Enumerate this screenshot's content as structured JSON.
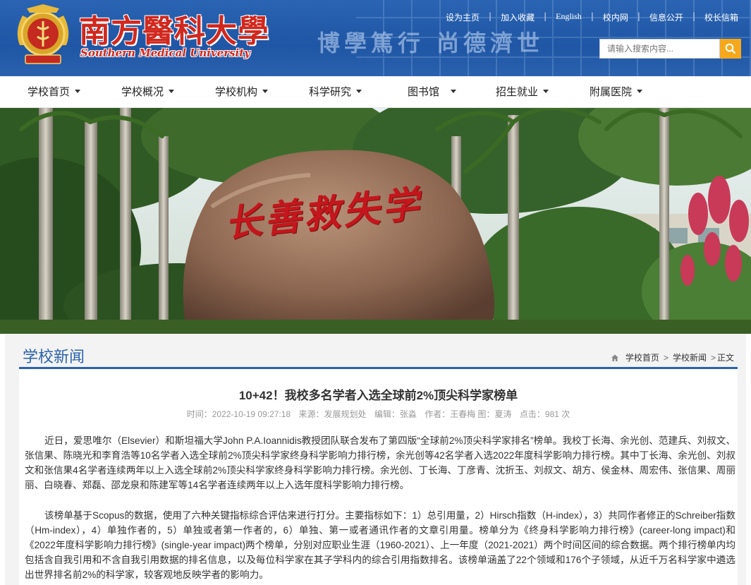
{
  "header": {
    "logo_cn": "南方醫科大學",
    "logo_en": "Southern Medical University",
    "motto": "博學篤行 尚德濟世",
    "top_links": [
      "设为主页",
      "加入收藏",
      "English",
      "校内网",
      "信息公开",
      "校长信箱"
    ],
    "search_placeholder": "请输入搜索内容..."
  },
  "nav": [
    "学校首页",
    "学校概况",
    "学校机构",
    "科学研究",
    "图书馆",
    "招生就业",
    "附属医院"
  ],
  "banner": {
    "rock_text": "长善救失学"
  },
  "section": {
    "title": "学校新闻",
    "breadcrumb": [
      "学校首页",
      "学校新闻",
      "正文"
    ]
  },
  "article": {
    "title": "10+42！我校多名学者入选全球前2%顶尖科学家榜单",
    "meta": {
      "time": "时间：2022-10-19 09:27:18",
      "source": "来源：发展规划处",
      "editor": "编辑：张淼",
      "author": "作者：王春梅 图：夏涛",
      "clicks": "点击：981 次"
    },
    "paragraphs": [
      "近日，爱思唯尔（Elsevier）和斯坦福大学John P.A.Ioannidis教授团队联合发布了第四版“全球前2%顶尖科学家排名”榜单。我校丁长海、余光创、范建兵、刘叔文、张信果、陈晓光和李育浩等10名学者入选全球前2%顶尖科学家终身科学影响力排行榜，余光创等42名学者入选2022年度科学影响力排行榜。其中丁长海、余光创、刘叔文和张信果4名学者连续两年以上入选全球前2%顶尖科学家终身科学影响力排行榜。余光创、丁长海、丁彦青、沈折玉、刘叔文、胡方、侯金林、周宏伟、张信果、周丽丽、白晓春、郑磊、邵龙泉和陈建军等14名学者连续两年以上入选年度科学影响力排行榜。",
      "该榜单基于Scopus的数据，使用了六种关键指标综合评估来进行打分。主要指标如下：1）总引用量，2）Hirsch指数（H-index），3）共同作者修正的Schreiber指数（Hm-index），4）单独作者的，5）单独或者第一作者的，6）单独、第一或者通讯作者的文章引用量。榜单分为《终身科学影响力排行榜》(career-long impact)和《2022年度科学影响力排行榜》(single-year impact)两个榜单，分别对应职业生涯（1960-2021）、上一年度（2021-2021）两个时间区间的综合数据。两个排行榜单内均包括含自我引用和不含自我引用数据的排名信息，以及每位科学家在其子学科内的综合引用指数排名。该榜单涵盖了22个领域和176个子领域，从近千万名科学家中遴选出世界排名前2%的科学家，较客观地反映学者的影响力。"
    ]
  }
}
